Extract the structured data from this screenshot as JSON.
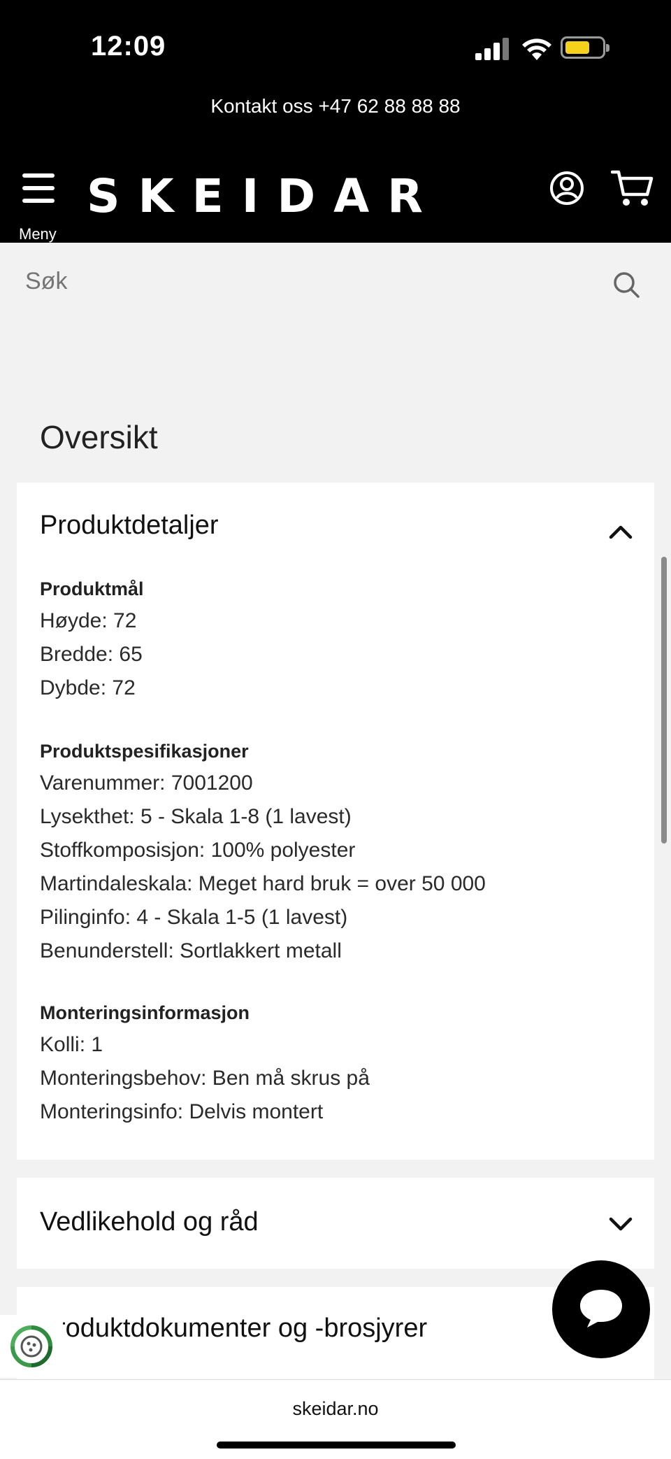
{
  "status": {
    "time": "12:09",
    "battery_color": "#f4d21c"
  },
  "contact_bar": {
    "text": "Kontakt oss +47 62 88 88 88"
  },
  "header": {
    "menu_label": "Meny",
    "logo": "SKEIDAR",
    "icons": [
      "menu-icon",
      "account-icon",
      "cart-icon"
    ]
  },
  "search": {
    "placeholder": "Søk",
    "icon": "search-icon"
  },
  "overview": {
    "title": "Oversikt"
  },
  "product_details": {
    "title": "Produktdetaljer",
    "expanded": true,
    "sections": [
      {
        "heading": "Produktmål",
        "lines": [
          "Høyde: 72",
          "Bredde: 65",
          "Dybde: 72"
        ]
      },
      {
        "heading": "Produktspesifikasjoner",
        "lines": [
          "Varenummer: 7001200",
          "Lysekthet: 5 - Skala 1-8 (1 lavest)",
          "Stoffkomposisjon: 100% polyester",
          "Martindaleskala: Meget hard bruk = over 50 000",
          "Pilinginfo: 4 - Skala 1-5 (1 lavest)",
          "Benunderstell: Sortlakkert metall"
        ]
      },
      {
        "heading": "Monteringsinformasjon",
        "lines": [
          "Kolli: 1",
          "Monteringsbehov: Ben må skrus på",
          "Monteringsinfo: Delvis montert"
        ]
      }
    ]
  },
  "maintenance": {
    "title": "Vedlikehold og råd",
    "expanded": false
  },
  "documents": {
    "title": "Produktdokumenter og -brosjyrer",
    "visible_title": "roduktdokumenter og -brosjyrer"
  },
  "browser": {
    "url": "skeidar.no"
  }
}
